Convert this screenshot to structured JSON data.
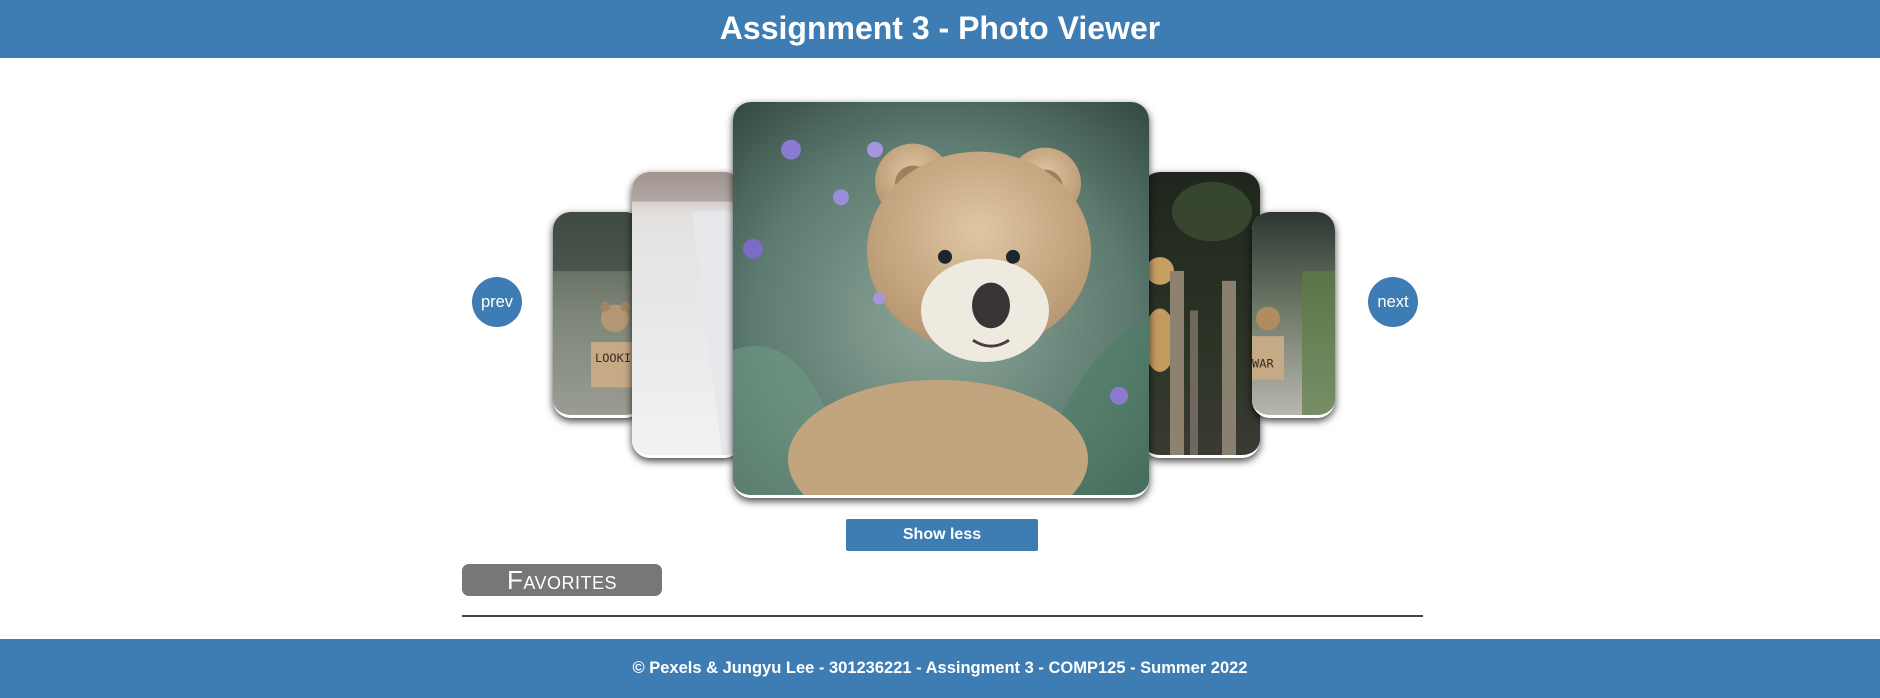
{
  "header": {
    "title": "Assignment 3 - Photo Viewer"
  },
  "carousel": {
    "prev_label": "prev",
    "next_label": "next",
    "photos": [
      {
        "subject": "teddy bear on road holding sign",
        "sign_text": "LOOKI FOR A FR"
      },
      {
        "subject": "snowy path"
      },
      {
        "subject": "teddy bear among wildflowers"
      },
      {
        "subject": "teddy bear behind wooden fence"
      },
      {
        "subject": "teddy bear on sidewalk holding sign",
        "sign_text": "WAR"
      }
    ]
  },
  "toggle": {
    "label": "Show less"
  },
  "favorites": {
    "title": "Favorites"
  },
  "footer": {
    "text": "© Pexels & Jungyu Lee - 301236221 - Assingment 3 - COMP125 - Summer 2022"
  }
}
